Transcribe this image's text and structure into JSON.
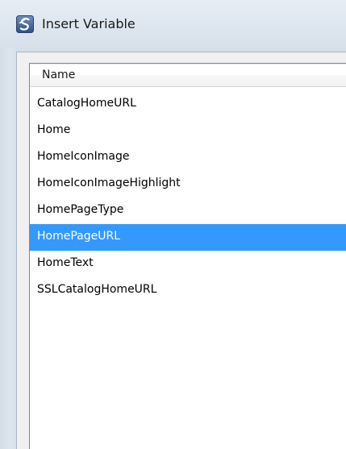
{
  "window": {
    "title": "Insert Variable",
    "app_icon": "s-logo-icon"
  },
  "list": {
    "column_header": "Name",
    "selected_index": 5,
    "selection_color": "#3399ff",
    "items": [
      {
        "label": "CatalogHomeURL"
      },
      {
        "label": "Home"
      },
      {
        "label": "HomeIconImage"
      },
      {
        "label": "HomeIconImageHighlight"
      },
      {
        "label": "HomePageType"
      },
      {
        "label": "HomePageURL"
      },
      {
        "label": "HomeText"
      },
      {
        "label": "SSLCatalogHomeURL"
      }
    ]
  }
}
